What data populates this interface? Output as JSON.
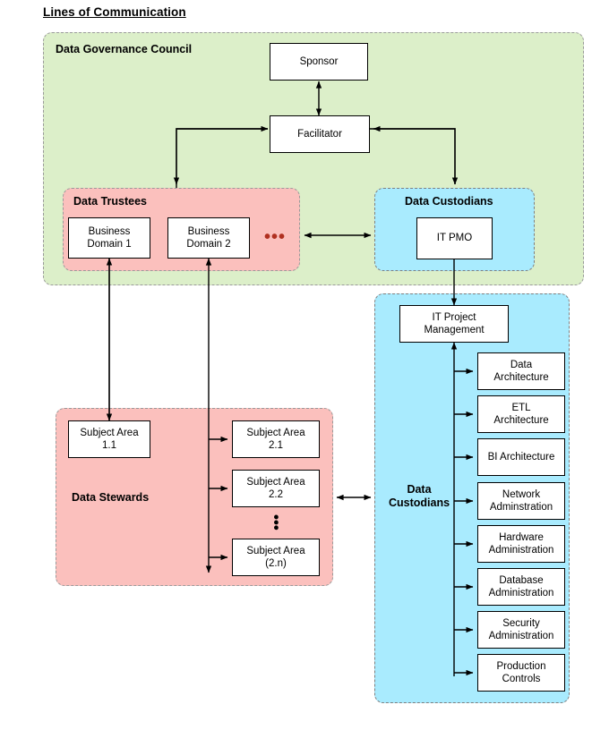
{
  "page": {
    "title": "Lines of Communication"
  },
  "groups": {
    "governance_council": {
      "label": "Data Governance Council",
      "color": "#dcefc9"
    },
    "data_trustees": {
      "label": "Data Trustees",
      "color": "#fbc0bd"
    },
    "data_custodians_top": {
      "label": "Data Custodians",
      "color": "#a9ebfe"
    },
    "data_stewards": {
      "label": "Data Stewards",
      "color": "#fbc0bd"
    },
    "data_custodians_bottom": {
      "label": "Data\nCustodians",
      "color": "#a9ebfe"
    }
  },
  "nodes": {
    "sponsor": "Sponsor",
    "facilitator": "Facilitator",
    "business_domain_1": "Business\nDomain 1",
    "business_domain_2": "Business\nDomain 2",
    "trustees_ellipsis": "•••",
    "it_pmo": "IT PMO",
    "subject_area_1_1": "Subject Area\n1.1",
    "subject_area_2_1": "Subject Area\n2.1",
    "subject_area_2_2": "Subject Area\n2.2",
    "subject_areas_ellipsis": "•••",
    "subject_area_2_n": "Subject Area\n(2.n)",
    "it_project_management": "IT Project\nManagement",
    "data_architecture": "Data\nArchitecture",
    "etl_architecture": "ETL\nArchitecture",
    "bi_architecture": "BI Architecture",
    "network_administration": "Network\nAdminstration",
    "hardware_administration": "Hardware\nAdministration",
    "database_administration": "Database\nAdministration",
    "security_administration": "Security\nAdministration",
    "production_controls": "Production\nControls"
  },
  "colors": {
    "green_fill": "#dcefc9",
    "pink_fill": "#fbc0bd",
    "blue_fill": "#a9ebfe",
    "node_fill": "#ffffff",
    "stroke": "#000000",
    "dashed_border": "#9a9a9a"
  }
}
